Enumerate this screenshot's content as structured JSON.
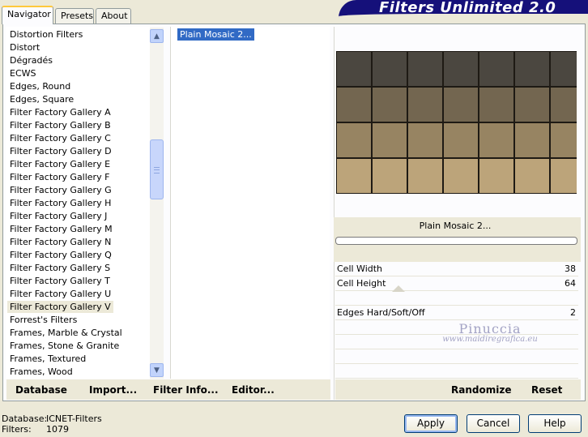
{
  "tabs": {
    "navigator": "Navigator",
    "presets": "Presets",
    "about": "About"
  },
  "app_title": "Filters Unlimited 2.0",
  "categories": [
    "Distortion Filters",
    "Distort",
    "Dégradés",
    "ECWS",
    "Edges, Round",
    "Edges, Square",
    "Filter Factory Gallery A",
    "Filter Factory Gallery B",
    "Filter Factory Gallery C",
    "Filter Factory Gallery D",
    "Filter Factory Gallery E",
    "Filter Factory Gallery F",
    "Filter Factory Gallery G",
    "Filter Factory Gallery H",
    "Filter Factory Gallery J",
    "Filter Factory Gallery M",
    "Filter Factory Gallery N",
    "Filter Factory Gallery Q",
    "Filter Factory Gallery S",
    "Filter Factory Gallery T",
    "Filter Factory Gallery U",
    "Filter Factory Gallery V",
    "Forrest's Filters",
    "Frames, Marble & Crystal",
    "Frames, Stone & Granite",
    "Frames, Textured",
    "Frames, Wood"
  ],
  "selected_category": "Filter Factory Gallery V",
  "filters": [
    "Plain Mosaic 2..."
  ],
  "selected_filter": "Plain Mosaic 2...",
  "preview": {
    "row_colors": [
      "#4b4740",
      "#736650",
      "#978462",
      "#bca47a"
    ]
  },
  "filter_name": "Plain Mosaic 2...",
  "params": [
    {
      "label": "Cell Width",
      "value": "38"
    },
    {
      "label": "Cell Height",
      "value": "64"
    },
    {
      "label": "",
      "value": ""
    },
    {
      "label": "Edges Hard/Soft/Off",
      "value": "2"
    }
  ],
  "watermark": {
    "name": "Pinuccia",
    "site": "www.maidiregrafica.eu"
  },
  "toolbar": {
    "database": "Database",
    "import": "Import...",
    "filter_info": "Filter Info...",
    "editor": "Editor...",
    "randomize": "Randomize",
    "reset": "Reset"
  },
  "footer": {
    "database_label": "Database:",
    "database_value": "ICNET-Filters",
    "filters_label": "Filters:",
    "filters_value": "1079"
  },
  "buttons": {
    "apply": "Apply",
    "cancel": "Cancel",
    "help": "Help"
  },
  "colors": {
    "title_banner": "#15107a",
    "selection": "#316ac5",
    "window_bg": "#ece9d8"
  }
}
